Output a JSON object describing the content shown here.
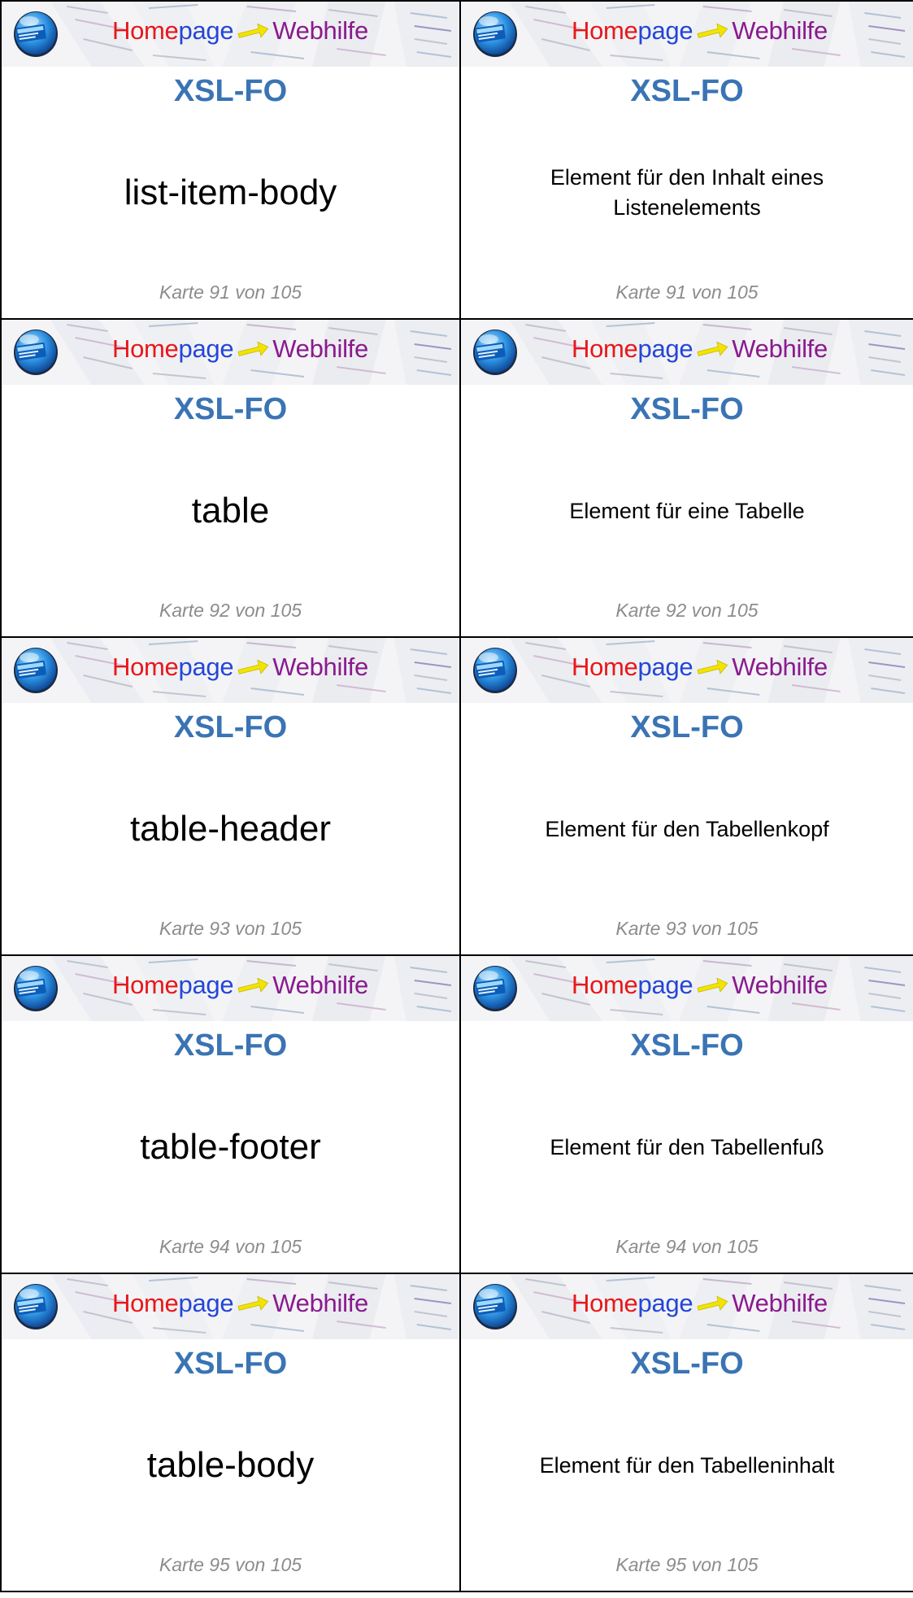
{
  "banner": {
    "brand_home": "Home",
    "brand_page": "page",
    "brand_web": "Web",
    "brand_hilfe": "hilfe",
    "logo_icon": "globe-monitor-logo-icon"
  },
  "cards": [
    {
      "front": {
        "title": "XSL-FO",
        "term": "list-item-body",
        "footer": "Karte 91 von 105"
      },
      "back": {
        "title": "XSL-FO",
        "definition": "Element für den Inhalt eines Listenelements",
        "footer": "Karte 91 von 105"
      }
    },
    {
      "front": {
        "title": "XSL-FO",
        "term": "table",
        "footer": "Karte 92 von 105"
      },
      "back": {
        "title": "XSL-FO",
        "definition": "Element für eine Tabelle",
        "footer": "Karte 92 von 105"
      }
    },
    {
      "front": {
        "title": "XSL-FO",
        "term": "table-header",
        "footer": "Karte 93 von 105"
      },
      "back": {
        "title": "XSL-FO",
        "definition": "Element für den Tabellenkopf",
        "footer": "Karte 93 von 105"
      }
    },
    {
      "front": {
        "title": "XSL-FO",
        "term": "table-footer",
        "footer": "Karte 94 von 105"
      },
      "back": {
        "title": "XSL-FO",
        "definition": "Element für den Tabellenfuß",
        "footer": "Karte 94 von 105"
      }
    },
    {
      "front": {
        "title": "XSL-FO",
        "term": "table-body",
        "footer": "Karte 95 von 105"
      },
      "back": {
        "title": "XSL-FO",
        "definition": "Element für den Tabelleninhalt",
        "footer": "Karte 95 von 105"
      }
    }
  ],
  "colors": {
    "title": "#3a74b4",
    "footer": "#8c8c8c",
    "brand_home": "#e8171a",
    "brand_page": "#2446d6",
    "brand_web": "#8a1a8e",
    "arrow": "#f3e400"
  }
}
